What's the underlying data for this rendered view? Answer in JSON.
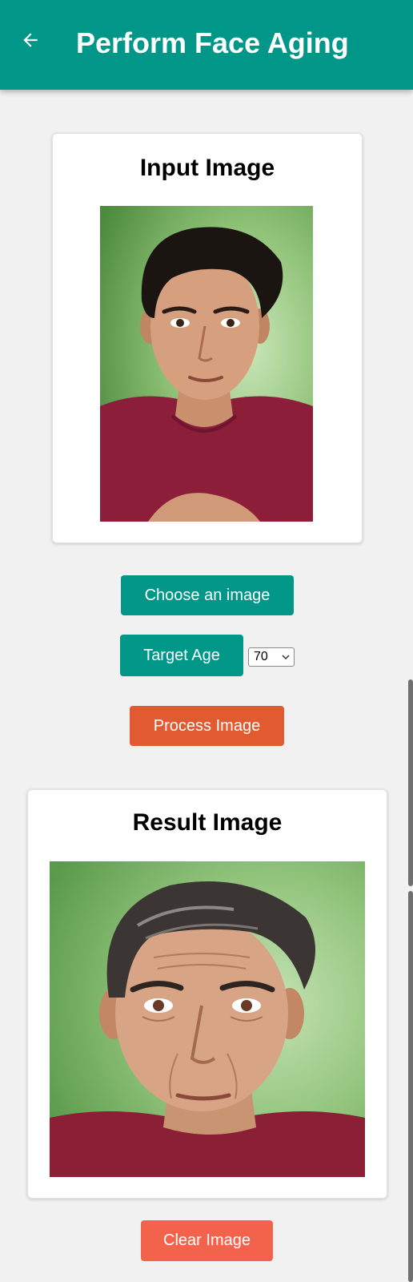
{
  "header": {
    "title": "Perform Face Aging",
    "back_icon": "arrow-left-icon"
  },
  "input_card": {
    "title": "Input Image"
  },
  "controls": {
    "choose_label": "Choose an image",
    "target_age_label": "Target Age",
    "age_selected": "70",
    "process_label": "Process Image"
  },
  "result_card": {
    "title": "Result Image"
  },
  "footer": {
    "clear_label": "Clear Image"
  },
  "colors": {
    "app_bar": "#009688",
    "primary_button": "#009688",
    "process_button": "#e15a30",
    "clear_button": "#f3634b",
    "background": "#f1f1f1"
  }
}
